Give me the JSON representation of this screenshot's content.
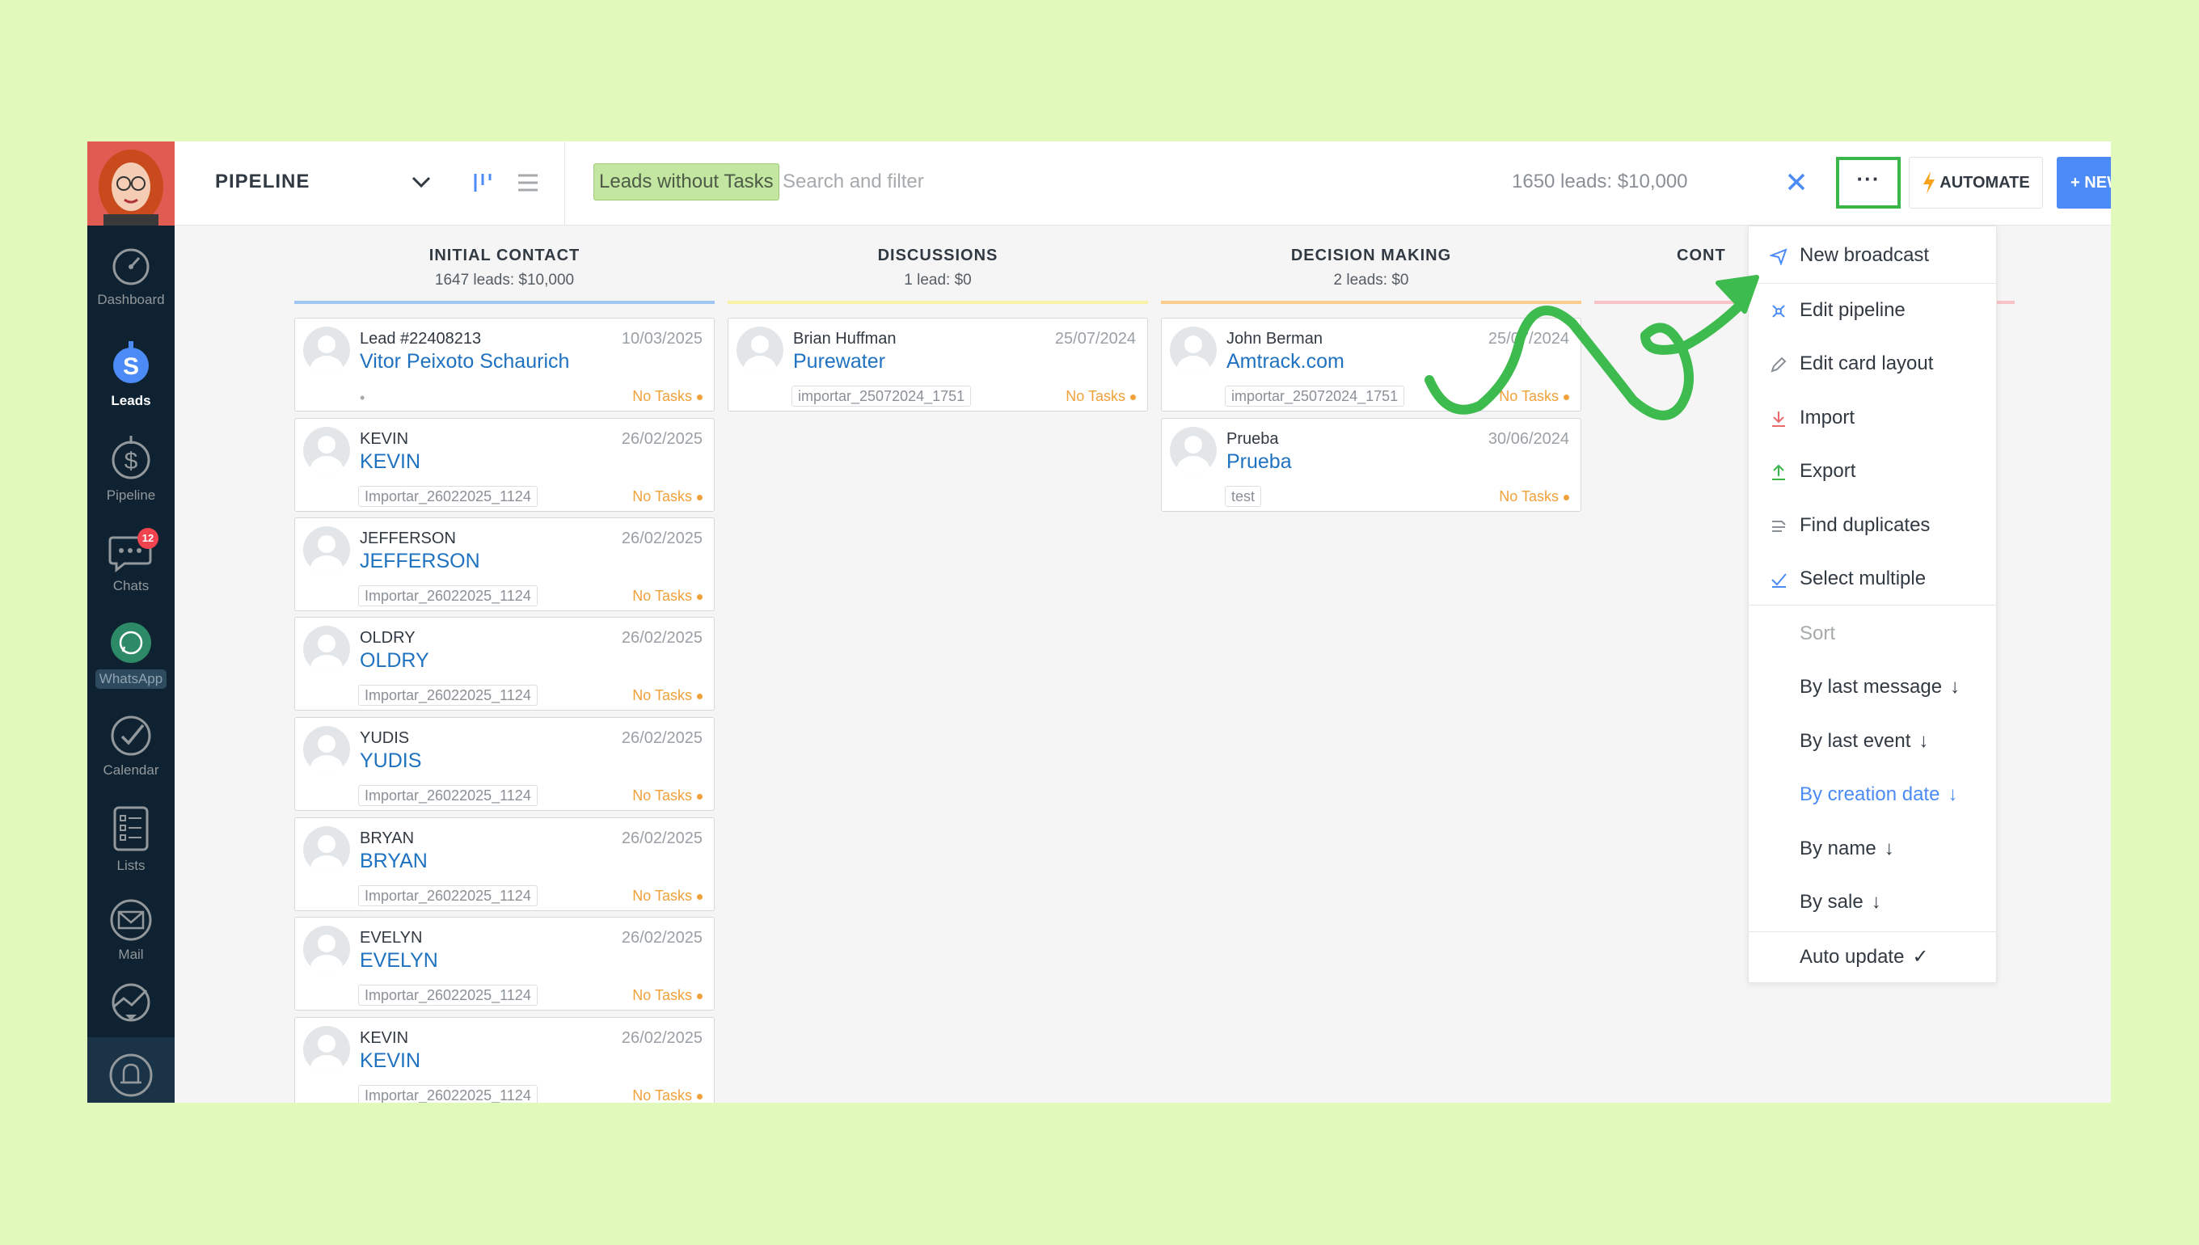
{
  "sidebar": {
    "items": [
      {
        "id": "dashboard",
        "label": "Dashboard"
      },
      {
        "id": "leads",
        "label": "Leads"
      },
      {
        "id": "pipeline",
        "label": "Pipeline"
      },
      {
        "id": "chats",
        "label": "Chats",
        "badge": "12"
      },
      {
        "id": "whatsapp",
        "label": "WhatsApp"
      },
      {
        "id": "calendar",
        "label": "Calendar"
      },
      {
        "id": "lists",
        "label": "Lists"
      },
      {
        "id": "mail",
        "label": "Mail"
      }
    ]
  },
  "topbar": {
    "title": "PIPELINE",
    "filter_tag": "Leads without Tasks",
    "search_placeholder": "Search and filter",
    "summary": "1650 leads: $10,000",
    "more_label": "···",
    "automate_label": "AUTOMATE",
    "new_lead_label": "+ NEW LEAD"
  },
  "columns": [
    {
      "title": "INITIAL CONTACT",
      "summary": "1647 leads: $10,000",
      "color": "#9fc7f0"
    },
    {
      "title": "DISCUSSIONS",
      "summary": "1 lead: $0",
      "color": "#f9f1a5"
    },
    {
      "title": "DECISION MAKING",
      "summary": "2 leads: $0",
      "color": "#f9cd8c"
    },
    {
      "title": "CONT",
      "summary": "",
      "color": "#f8c3c7"
    }
  ],
  "cards": {
    "initial_contact": [
      {
        "name": "Lead #22408213",
        "date": "10/03/2025",
        "title": "Vitor Peixoto Schaurich",
        "tag": "",
        "dot": "•",
        "tasks": "No Tasks"
      },
      {
        "name": "KEVIN",
        "date": "26/02/2025",
        "title": "KEVIN",
        "tag": "Importar_26022025_1124",
        "tasks": "No Tasks"
      },
      {
        "name": "JEFFERSON",
        "date": "26/02/2025",
        "title": "JEFFERSON",
        "tag": "Importar_26022025_1124",
        "tasks": "No Tasks"
      },
      {
        "name": "OLDRY",
        "date": "26/02/2025",
        "title": "OLDRY",
        "tag": "Importar_26022025_1124",
        "tasks": "No Tasks"
      },
      {
        "name": "YUDIS",
        "date": "26/02/2025",
        "title": "YUDIS",
        "tag": "Importar_26022025_1124",
        "tasks": "No Tasks"
      },
      {
        "name": "BRYAN",
        "date": "26/02/2025",
        "title": "BRYAN",
        "tag": "Importar_26022025_1124",
        "tasks": "No Tasks"
      },
      {
        "name": "EVELYN",
        "date": "26/02/2025",
        "title": "EVELYN",
        "tag": "Importar_26022025_1124",
        "tasks": "No Tasks"
      },
      {
        "name": "KEVIN",
        "date": "26/02/2025",
        "title": "KEVIN",
        "tag": "Importar_26022025_1124",
        "tasks": "No Tasks"
      }
    ],
    "discussions": [
      {
        "name": "Brian Huffman",
        "date": "25/07/2024",
        "title": "Purewater",
        "tag": "importar_25072024_1751",
        "tasks": "No Tasks"
      }
    ],
    "decision_making": [
      {
        "name": "John Berman",
        "date": "25/07/2024",
        "title": "Amtrack.com",
        "tag": "importar_25072024_1751",
        "tasks": "No Tasks"
      },
      {
        "name": "Prueba",
        "date": "30/06/2024",
        "title": "Prueba",
        "tag": "test",
        "tasks": "No Tasks"
      }
    ]
  },
  "menu": {
    "new_broadcast": "New broadcast",
    "edit_pipeline": "Edit pipeline",
    "edit_card_layout": "Edit card layout",
    "import": "Import",
    "export": "Export",
    "find_duplicates": "Find duplicates",
    "select_multiple": "Select multiple",
    "sort_heading": "Sort",
    "by_last_message": "By last message",
    "by_last_event": "By last event",
    "by_creation_date": "By creation date",
    "by_name": "By name",
    "by_sale": "By sale",
    "auto_update": "Auto update",
    "active_sort": "by_creation_date"
  },
  "colors": {
    "accent": "#4c8bf5",
    "highlight_box": "#39b54a",
    "annotation_arrow": "#3dbb4e",
    "no_tasks": "#f0a13a",
    "link": "#1f72c0"
  }
}
